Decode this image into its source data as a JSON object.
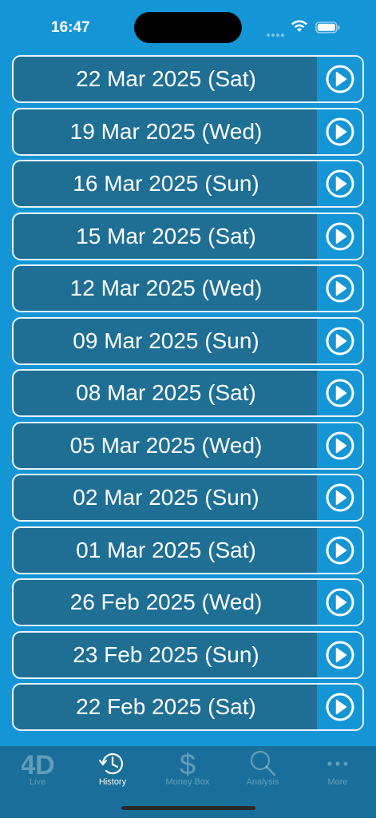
{
  "status_bar": {
    "time": "16:47"
  },
  "history": {
    "dates": [
      "22 Mar 2025 (Sat)",
      "19 Mar 2025 (Wed)",
      "16 Mar 2025 (Sun)",
      "15 Mar 2025 (Sat)",
      "12 Mar 2025 (Wed)",
      "09 Mar 2025 (Sun)",
      "08 Mar 2025 (Sat)",
      "05 Mar 2025 (Wed)",
      "02 Mar 2025 (Sun)",
      "01 Mar 2025 (Sat)",
      "26 Feb 2025 (Wed)",
      "23 Feb 2025 (Sun)",
      "22 Feb 2025 (Sat)"
    ]
  },
  "tabbar": {
    "tabs": [
      {
        "label": "Live",
        "icon": "4d-logo-icon",
        "active": false
      },
      {
        "label": "History",
        "icon": "history-clock-icon",
        "active": true
      },
      {
        "label": "Money Box",
        "icon": "dollar-icon",
        "active": false
      },
      {
        "label": "Analysis",
        "icon": "magnifier-icon",
        "active": false
      },
      {
        "label": "More",
        "icon": "more-dots-icon",
        "active": false
      }
    ]
  },
  "colors": {
    "background": "#1496d6",
    "row_fill": "#1f6f95",
    "tabbar": "#196f99",
    "text": "#ffffff"
  }
}
